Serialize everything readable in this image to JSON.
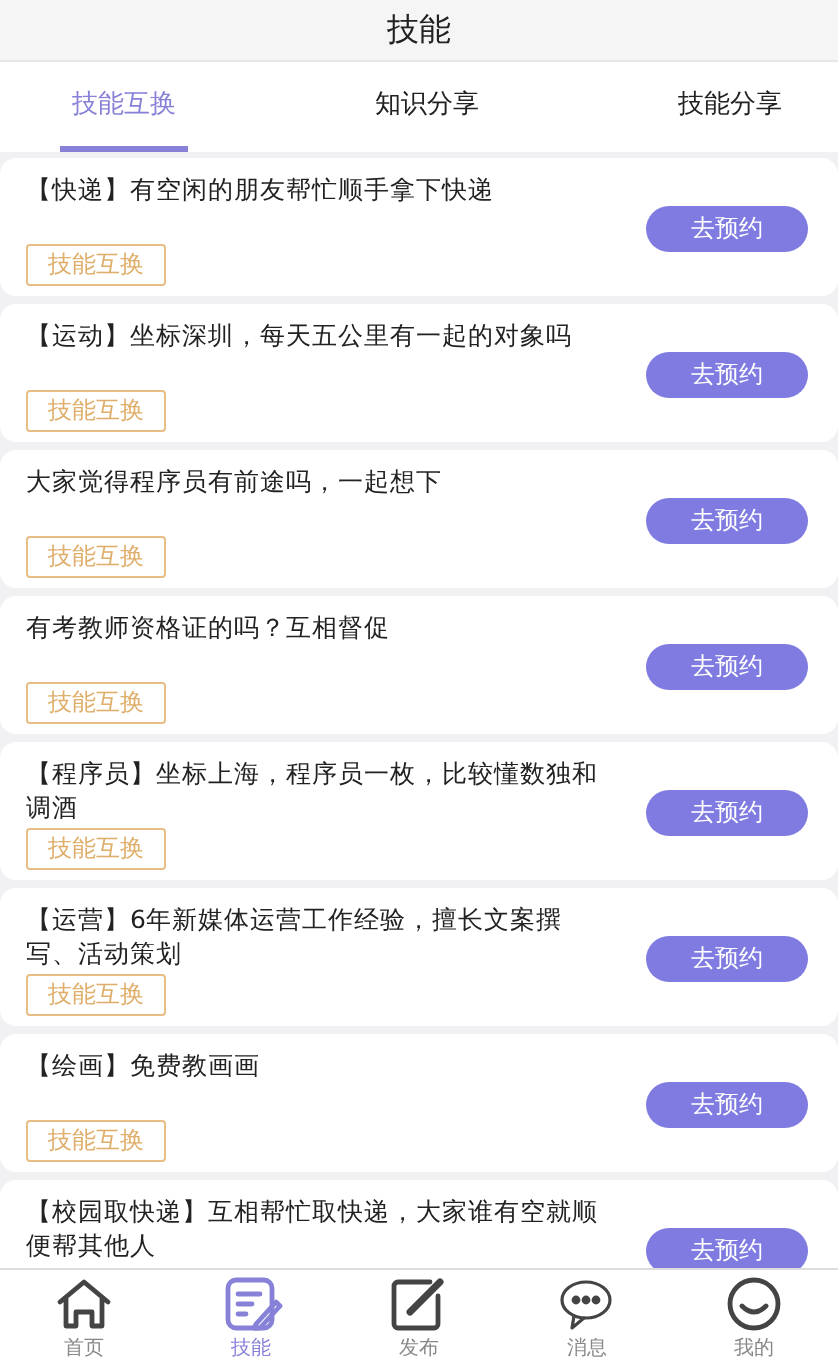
{
  "header": {
    "title": "技能"
  },
  "tabs": [
    {
      "label": "技能互换",
      "selected": true
    },
    {
      "label": "知识分享",
      "selected": false
    },
    {
      "label": "技能分享",
      "selected": false
    }
  ],
  "posts": [
    {
      "text": "【快递】有空闲的朋友帮忙顺手拿下快递",
      "tag": "技能互换",
      "button": "去预约"
    },
    {
      "text": "【运动】坐标深圳，每天五公里有一起的对象吗",
      "tag": "技能互换",
      "button": "去预约"
    },
    {
      "text": "大家觉得程序员有前途吗，一起想下",
      "tag": "技能互换",
      "button": "去预约"
    },
    {
      "text": "有考教师资格证的吗？互相督促",
      "tag": "技能互换",
      "button": "去预约"
    },
    {
      "text": "【程序员】坐标上海，程序员一枚，比较懂数独和调酒",
      "tag": "技能互换",
      "button": "去预约"
    },
    {
      "text": "【运营】6年新媒体运营工作经验，擅长文案撰写、活动策划",
      "tag": "技能互换",
      "button": "去预约"
    },
    {
      "text": "【绘画】免费教画画",
      "tag": "技能互换",
      "button": "去预约"
    },
    {
      "text": "【校园取快递】互相帮忙取快递，大家谁有空就顺便帮其他人",
      "button": "去预约"
    }
  ],
  "nav": [
    {
      "kind": "home",
      "label": "首页",
      "selected": false
    },
    {
      "kind": "skills",
      "label": "技能",
      "selected": true
    },
    {
      "kind": "publish",
      "label": "发布",
      "selected": false
    },
    {
      "kind": "messages",
      "label": "消息",
      "selected": false
    },
    {
      "kind": "profile",
      "label": "我的",
      "selected": false
    }
  ]
}
